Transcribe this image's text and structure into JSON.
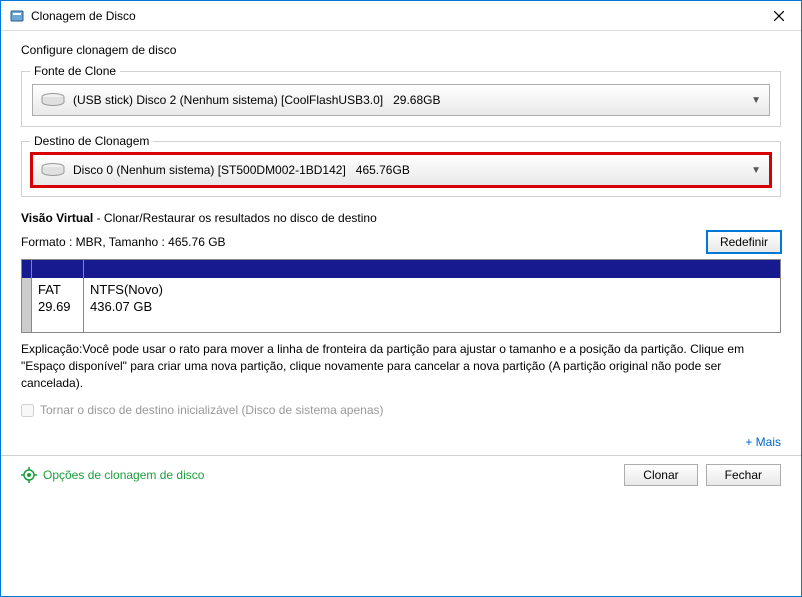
{
  "window": {
    "title": "Clonagem de Disco",
    "subtitle": "Configure clonagem de disco"
  },
  "source": {
    "label": "Fonte de Clone",
    "text": "(USB stick) Disco 2 (Nenhum sistema) [CoolFlashUSB3.0]   29.68GB"
  },
  "dest": {
    "label": "Destino de Clonagem",
    "text": "Disco 0 (Nenhum sistema) [ST500DM002-1BD142]   465.76GB"
  },
  "virtual": {
    "title_bold": "Visão Virtual",
    "title_rest": " - Clonar/Restaurar os resultados no disco de destino",
    "format": "Formato : MBR,  Tamanho : 465.76 GB",
    "redefine": "Redefinir",
    "p1_name": "FAT",
    "p1_size": "29.69",
    "p2_name": "NTFS(Novo)",
    "p2_size": "436.07 GB"
  },
  "explain": "Explicação:Você pode usar o rato para mover a linha de fronteira da partição para ajustar o tamanho e a posição da partição. Clique em \"Espaço disponível\" para criar uma nova partição, clique novamente para cancelar a nova partição (A partição original não pode ser cancelada).",
  "bootable": "Tornar o disco de destino inicializável (Disco de sistema apenas)",
  "more": "+ Mais",
  "footer": {
    "options": "Opções de clonagem de disco",
    "clone": "Clonar",
    "close": "Fechar"
  }
}
